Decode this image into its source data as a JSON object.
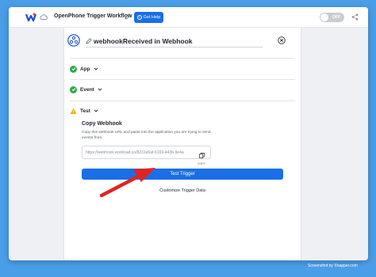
{
  "header": {
    "workflow_title": "OpenPhone Trigger Workflow",
    "help_label": "Get Help",
    "toggle_label": "OFF"
  },
  "node": {
    "title": "webhookReceived in Webhook"
  },
  "sections": {
    "app": "App",
    "event": "Event",
    "test": "Test"
  },
  "webhook": {
    "heading": "Copy Webhook",
    "description": "Copy this webhook URL and paste into the application you are trying to send events from.",
    "url": "https://webhook.workload.co/8231e6af-6169-443b-9e4a",
    "copy_label": "COPY",
    "test_trigger_label": "Test Trigger",
    "customize_label": "Customize Trigger Data"
  },
  "watermark": "Screenshot by Xnapper.com",
  "colors": {
    "accent": "#1a6ee6",
    "success": "#2eaa4a",
    "warning": "#f2a900",
    "annotation": "#e02424",
    "background": "#4a9ee8"
  }
}
